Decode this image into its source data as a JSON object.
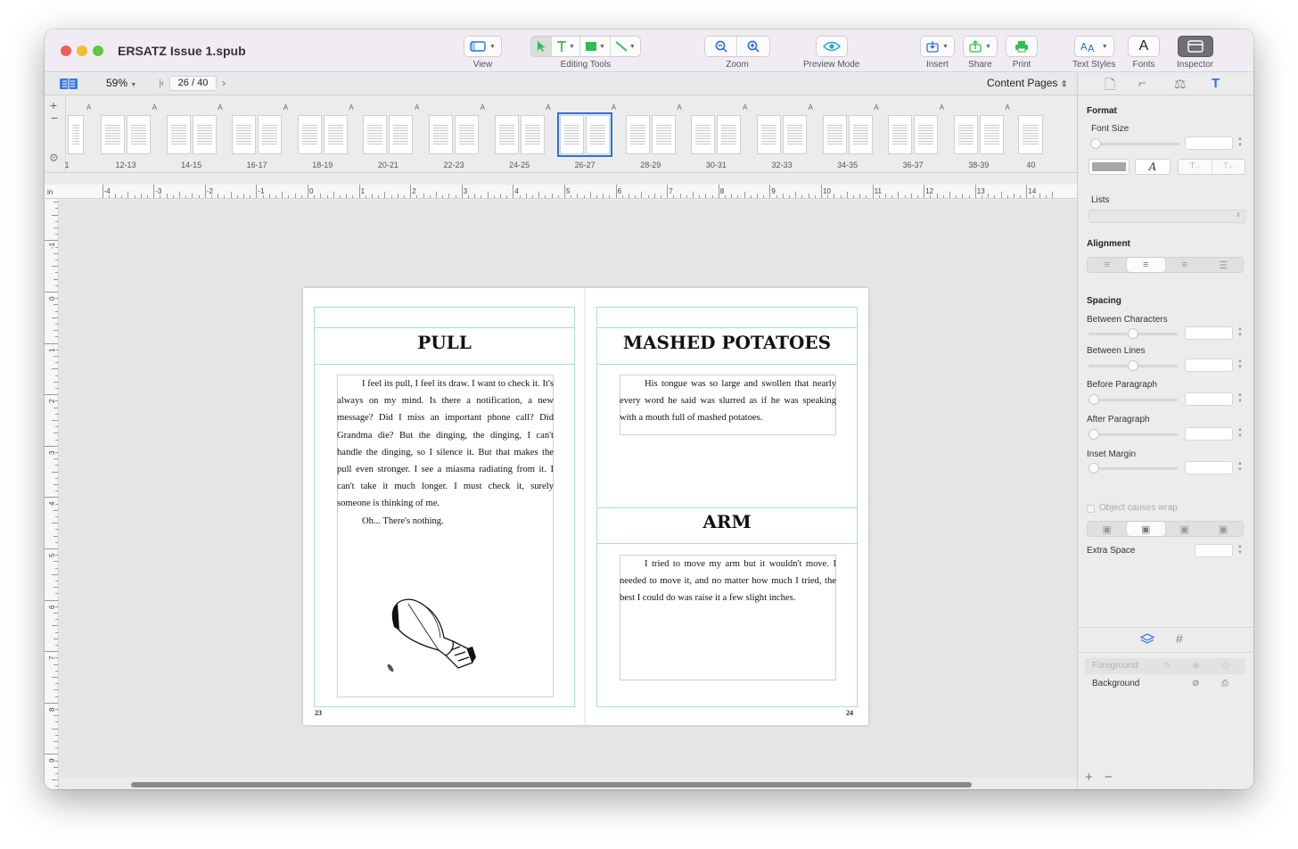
{
  "window": {
    "title": "ERSATZ Issue 1.spub"
  },
  "toolbar": {
    "view_label": "View",
    "editing_tools_label": "Editing Tools",
    "zoom_label": "Zoom",
    "preview_label": "Preview Mode",
    "insert_label": "Insert",
    "share_label": "Share",
    "print_label": "Print",
    "text_styles_label": "Text Styles",
    "fonts_label": "Fonts",
    "fonts_glyph": "A",
    "inspector_label": "Inspector"
  },
  "subbar": {
    "zoom_value": "59%",
    "page_indicator": "26 / 40",
    "section_select": "Content Pages"
  },
  "thumbnails": {
    "first_label": "1",
    "last_label": "40",
    "master_letter": "A",
    "spreads": [
      "12-13",
      "14-15",
      "16-17",
      "18-19",
      "20-21",
      "22-23",
      "24-25",
      "26-27",
      "28-29",
      "30-31",
      "32-33",
      "34-35",
      "36-37",
      "38-39"
    ],
    "selected": "26-27"
  },
  "ruler": {
    "unit": "in",
    "h_numbers": [
      "-4",
      "-3",
      "-2",
      "-1",
      "0",
      "1",
      "2",
      "3",
      "4",
      "5",
      "6",
      "7",
      "8",
      "9",
      "10",
      "11",
      "12",
      "13",
      "14"
    ],
    "v_numbers": [
      "-1",
      "0",
      "1",
      "2",
      "3",
      "4",
      "5",
      "6",
      "7",
      "8",
      "9"
    ]
  },
  "left_page": {
    "heading": "PULL",
    "paragraph1": "I feel its pull, I feel its draw. I want to check it. It's always on my mind. Is there a notification, a new message? Did I miss an important phone call? Did Grandma die? But the dinging, the dinging, I can't handle the dinging, so I silence it. But that makes the pull even stronger. I see a miasma radiating from it. I can't take it much longer. I must check it, surely someone is thinking of me.",
    "paragraph2": "Oh... There's nothing.",
    "page_number": "23",
    "illustration": "lightbulb-drawing"
  },
  "right_page": {
    "heading1": "MASHED POTATOES",
    "text1": "His tongue was so large and swollen that nearly every word he said was slurred as if he was speaking with a mouth full of mashed potatoes.",
    "heading2": "ARM",
    "text2": "I tried to move my arm but it wouldn't move. I needed to move it, and no matter how much I tried, the best I could do was raise it a few slight inches.",
    "page_number": "24"
  },
  "inspector": {
    "format_title": "Format",
    "font_size_label": "Font Size",
    "italic_glyph": "A",
    "subscript_glyph": "T₋",
    "superscript_glyph": "T₊",
    "lists_label": "Lists",
    "alignment_title": "Alignment",
    "spacing_title": "Spacing",
    "between_chars_label": "Between Characters",
    "between_lines_label": "Between Lines",
    "before_paragraph_label": "Before Paragraph",
    "after_paragraph_label": "After Paragraph",
    "inset_margin_label": "Inset Margin",
    "object_wrap_label": "Object causes wrap",
    "extra_space_label": "Extra Space",
    "layers": [
      "Foreground",
      "Background"
    ],
    "add_glyph": "+",
    "remove_glyph": "−"
  },
  "colors": {
    "accent": "#2d6fe0",
    "select_green": "#2fbf52",
    "guide": "#a9ddd6"
  }
}
